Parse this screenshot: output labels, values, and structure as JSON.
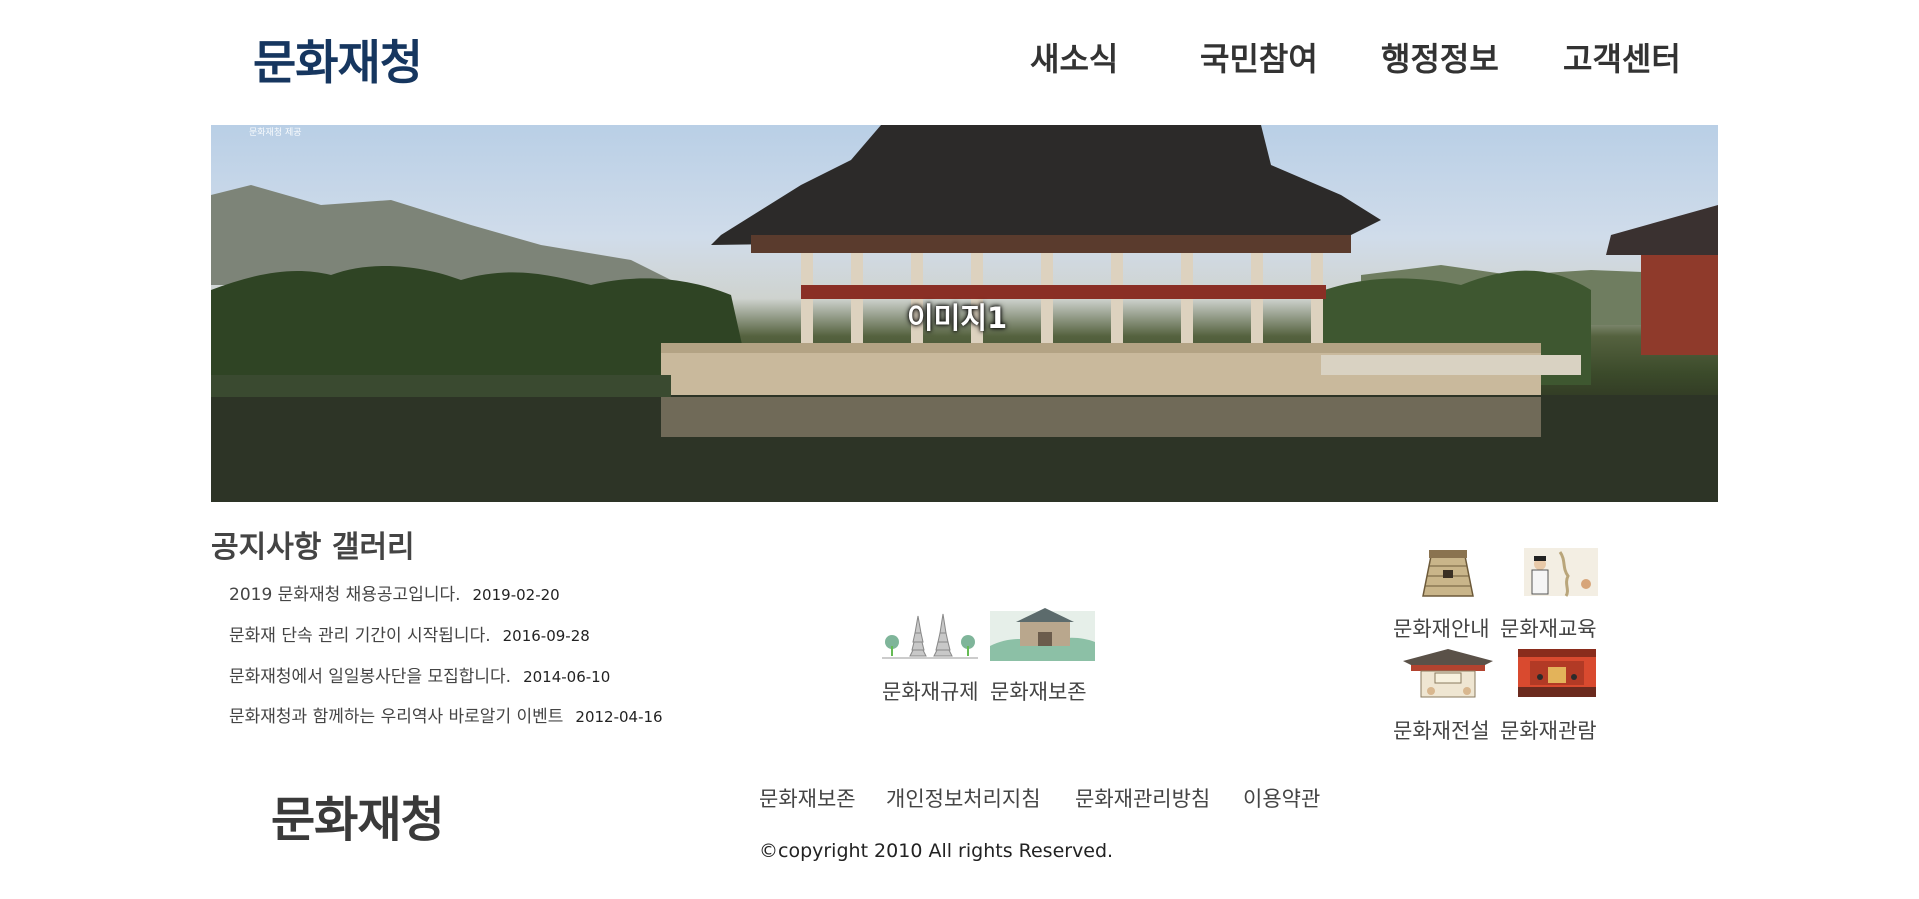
{
  "header": {
    "logo": "문화재청",
    "nav": [
      "새소식",
      "국민참여",
      "행정정보",
      "고객센터"
    ]
  },
  "hero": {
    "label": "이미지1",
    "caption": "문화재청 제공"
  },
  "notice_section": {
    "tabs": "공지사항  갤러리",
    "items": [
      {
        "title": "2019 문화재청 채용공고입니다.",
        "date": "2019-02-20"
      },
      {
        "title": "문화재 단속 관리 기간이 시작됩니다.",
        "date": "2016-09-28"
      },
      {
        "title": "문화재청에서 일일봉사단을 모집합니다.",
        "date": "2014-06-10"
      },
      {
        "title": "문화재청과 함께하는 우리역사 바로알기 이벤트",
        "date": "2012-04-16"
      }
    ]
  },
  "center_tiles": [
    {
      "label": "문화재규제",
      "icon": "pagoda-icon"
    },
    {
      "label": "문화재보존",
      "icon": "fortress-gate-icon"
    }
  ],
  "right_tiles": [
    {
      "label": "문화재안내",
      "icon": "observatory-icon"
    },
    {
      "label": "문화재교육",
      "icon": "scholar-map-icon"
    },
    {
      "label": "문화재전설",
      "icon": "palace-gate-icon"
    },
    {
      "label": "문화재관람",
      "icon": "hall-interior-icon"
    }
  ],
  "footer": {
    "logo": "문화재청",
    "links": [
      "문화재보존",
      "개인정보처리지침",
      "문화재관리방침",
      "이용약관"
    ],
    "copyright": "©copyright 2010 All rights Reserved."
  },
  "colors": {
    "logo": "#16365f",
    "text": "#333333",
    "footer_logo": "#3a3a3a"
  }
}
